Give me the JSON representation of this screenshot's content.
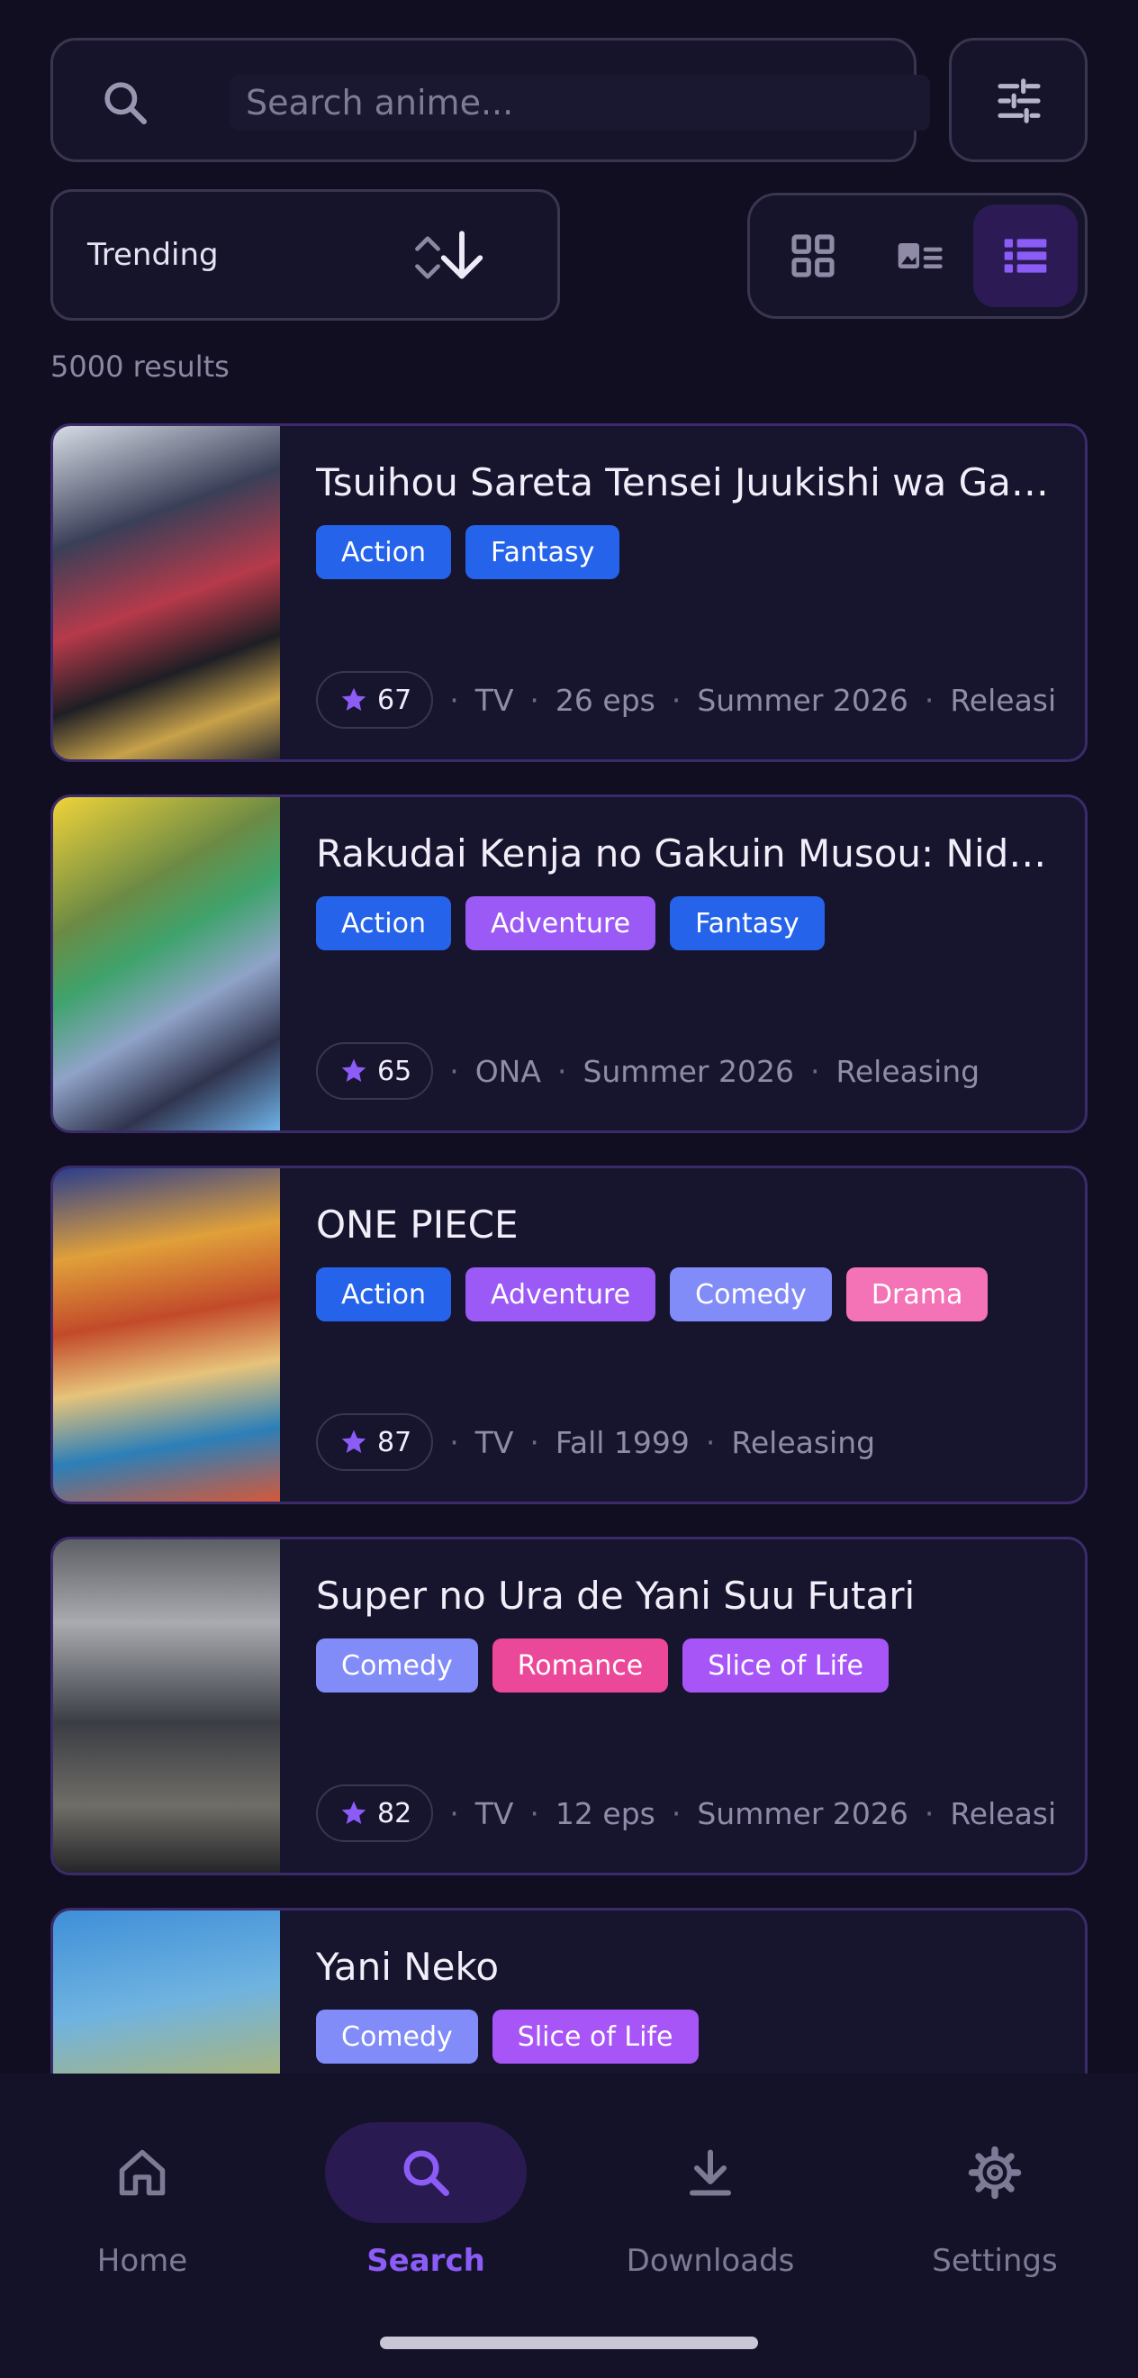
{
  "search": {
    "placeholder": "Search anime..."
  },
  "sort": {
    "label": "Trending"
  },
  "results_text": "5000 results",
  "colors": {
    "accent": "#8b5cf6",
    "tag_action": "#2563eb",
    "tag_fantasy": "#2563eb",
    "tag_adventure": "#9b59f5",
    "tag_comedy": "#818cf8",
    "tag_drama": "#f472b6",
    "tag_romance": "#ec4899",
    "tag_slice": "#a855f7"
  },
  "cards": [
    {
      "title": "Tsuihou Sareta Tensei Juukishi wa Game Chishiki de Musou Suru",
      "tags": [
        "Action",
        "Fantasy"
      ],
      "score": "67",
      "meta": [
        "TV",
        "26 eps",
        "Summer 2026",
        "Releasing"
      ]
    },
    {
      "title": "Rakudai Kenja no Gakuin Musou: Nidome no Tensei",
      "tags": [
        "Action",
        "Adventure",
        "Fantasy"
      ],
      "score": "65",
      "meta": [
        "ONA",
        "Summer 2026",
        "Releasing"
      ]
    },
    {
      "title": "ONE PIECE",
      "tags": [
        "Action",
        "Adventure",
        "Comedy",
        "Drama"
      ],
      "score": "87",
      "meta": [
        "TV",
        "Fall 1999",
        "Releasing"
      ]
    },
    {
      "title": "Super no Ura de Yani Suu Futari",
      "tags": [
        "Comedy",
        "Romance",
        "Slice of Life"
      ],
      "score": "82",
      "meta": [
        "TV",
        "12 eps",
        "Summer 2026",
        "Releasing"
      ]
    },
    {
      "title": "Yani Neko",
      "tags": [
        "Comedy",
        "Slice of Life"
      ]
    }
  ],
  "nav": {
    "home": "Home",
    "search": "Search",
    "downloads": "Downloads",
    "settings": "Settings"
  }
}
